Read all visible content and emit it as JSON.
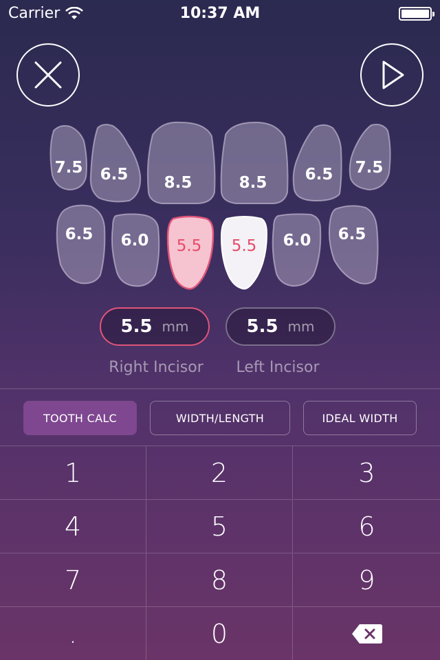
{
  "status_bar": {
    "carrier": "Carrier",
    "time": "10:37 AM"
  },
  "icons": {
    "close": "close-x-icon",
    "play": "play-icon",
    "wifi": "wifi-icon",
    "battery": "battery-icon",
    "backspace": "backspace-icon"
  },
  "teeth": {
    "upper": [
      "7.5",
      "6.5",
      "8.5",
      "8.5",
      "6.5",
      "7.5"
    ],
    "lower": [
      "6.5",
      "6.0",
      "5.5",
      "5.5",
      "6.0",
      "6.5"
    ]
  },
  "measurements": {
    "right_value": "5.5",
    "right_unit": "mm",
    "left_value": "5.5",
    "left_unit": "mm",
    "right_label": "Right Incisor",
    "left_label": "Left Incisor"
  },
  "modes": [
    "TOOTH CALC",
    "WIDTH/LENGTH",
    "IDEAL WIDTH"
  ],
  "keypad": [
    "1",
    "2",
    "3",
    "4",
    "5",
    "6",
    "7",
    "8",
    "9",
    ".",
    "0"
  ],
  "colors": {
    "accent": "#e0557a",
    "mode_active": "#7e4790"
  }
}
